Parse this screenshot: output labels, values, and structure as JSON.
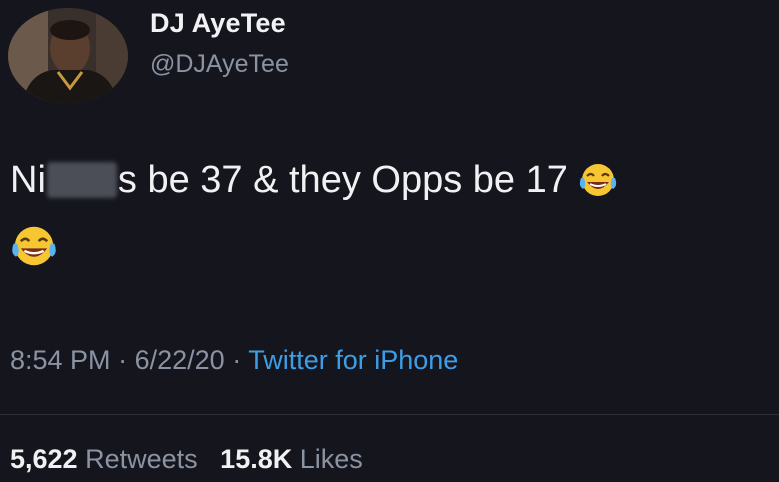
{
  "author": {
    "display_name": "DJ AyeTee",
    "handle": "@DJAyeTee"
  },
  "tweet": {
    "text_start": "Ni",
    "text_rest": "s be 37 & they Opps be 17",
    "emojis": [
      "face-with-tears-of-joy-icon",
      "face-with-tears-of-joy-icon"
    ]
  },
  "meta": {
    "time": "8:54 PM",
    "separator": "·",
    "date": "6/22/20",
    "source": "Twitter for iPhone"
  },
  "stats": {
    "retweets_count": "5,622",
    "retweets_label": "Retweets",
    "likes_count": "15.8K",
    "likes_label": "Likes"
  },
  "colors": {
    "background": "#15161d",
    "link": "#3d9ee8",
    "secondary_text": "#8b93a3"
  }
}
